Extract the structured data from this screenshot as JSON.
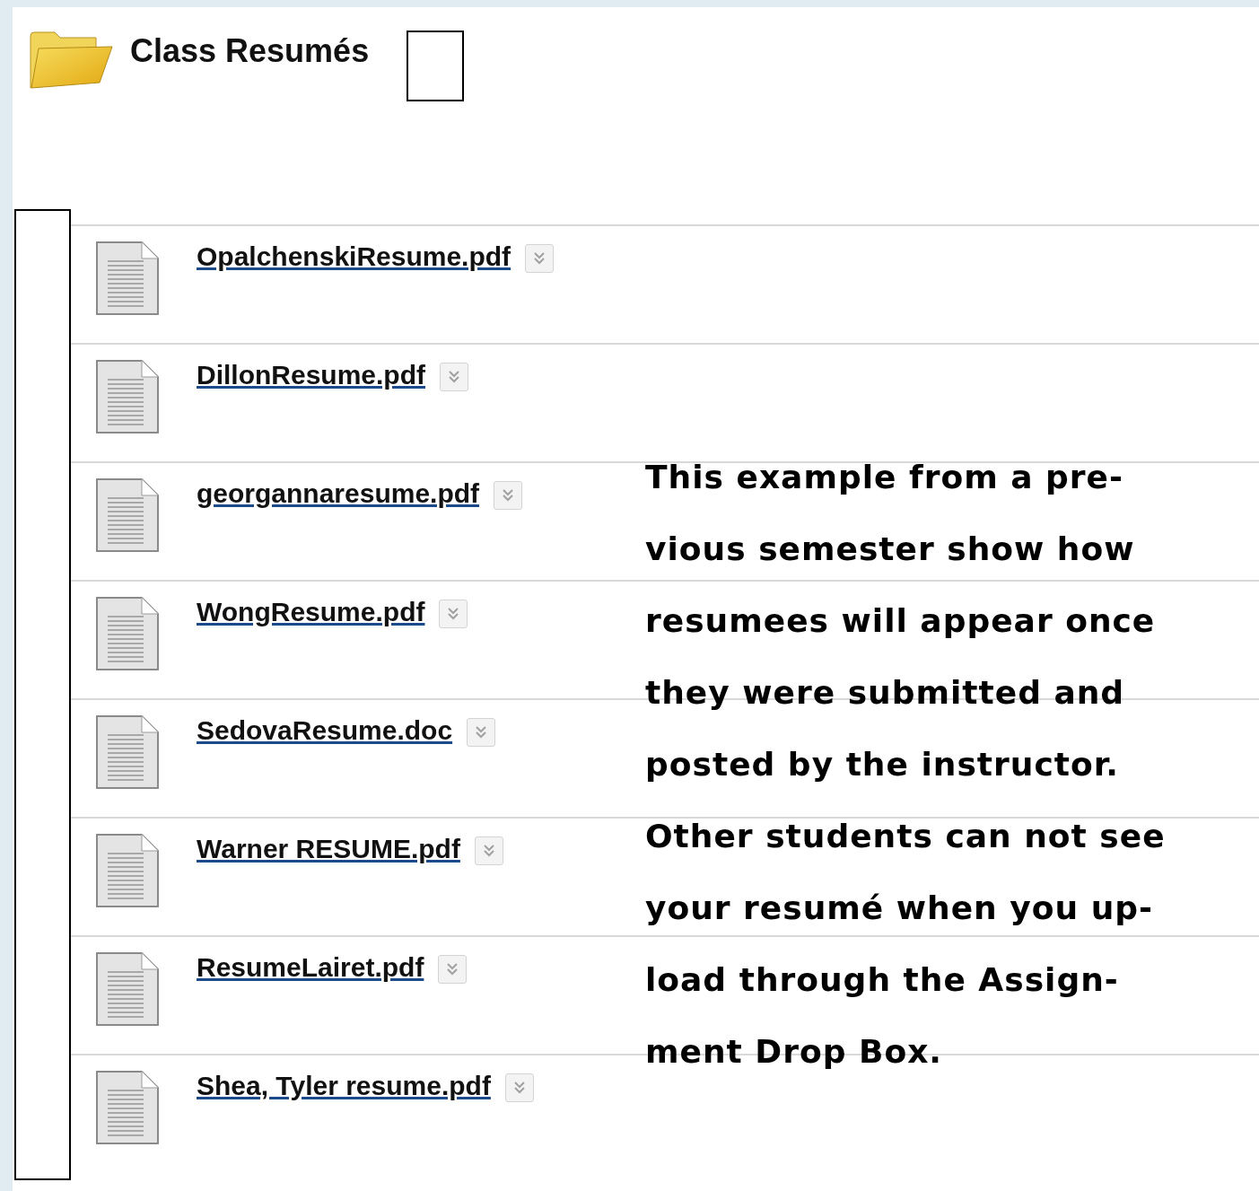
{
  "folder": {
    "title": "Class Resumés"
  },
  "files": [
    {
      "name": "OpalchenskiResume.pdf"
    },
    {
      "name": "DillonResume.pdf"
    },
    {
      "name": "georgannaresume.pdf"
    },
    {
      "name": "WongResume.pdf"
    },
    {
      "name": "SedovaResume.doc"
    },
    {
      "name": "Warner RESUME.pdf"
    },
    {
      "name": "ResumeLairet.pdf"
    },
    {
      "name": "Shea, Tyler resume.pdf"
    }
  ],
  "note": {
    "text": "This example from a pre-\nvious semester show how\nresumees will appear once\nthey were submitted and\nposted by the instructor.\nOther students can not see\nyour resumé when you up-\nload through the Assign-\nment Drop Box."
  }
}
